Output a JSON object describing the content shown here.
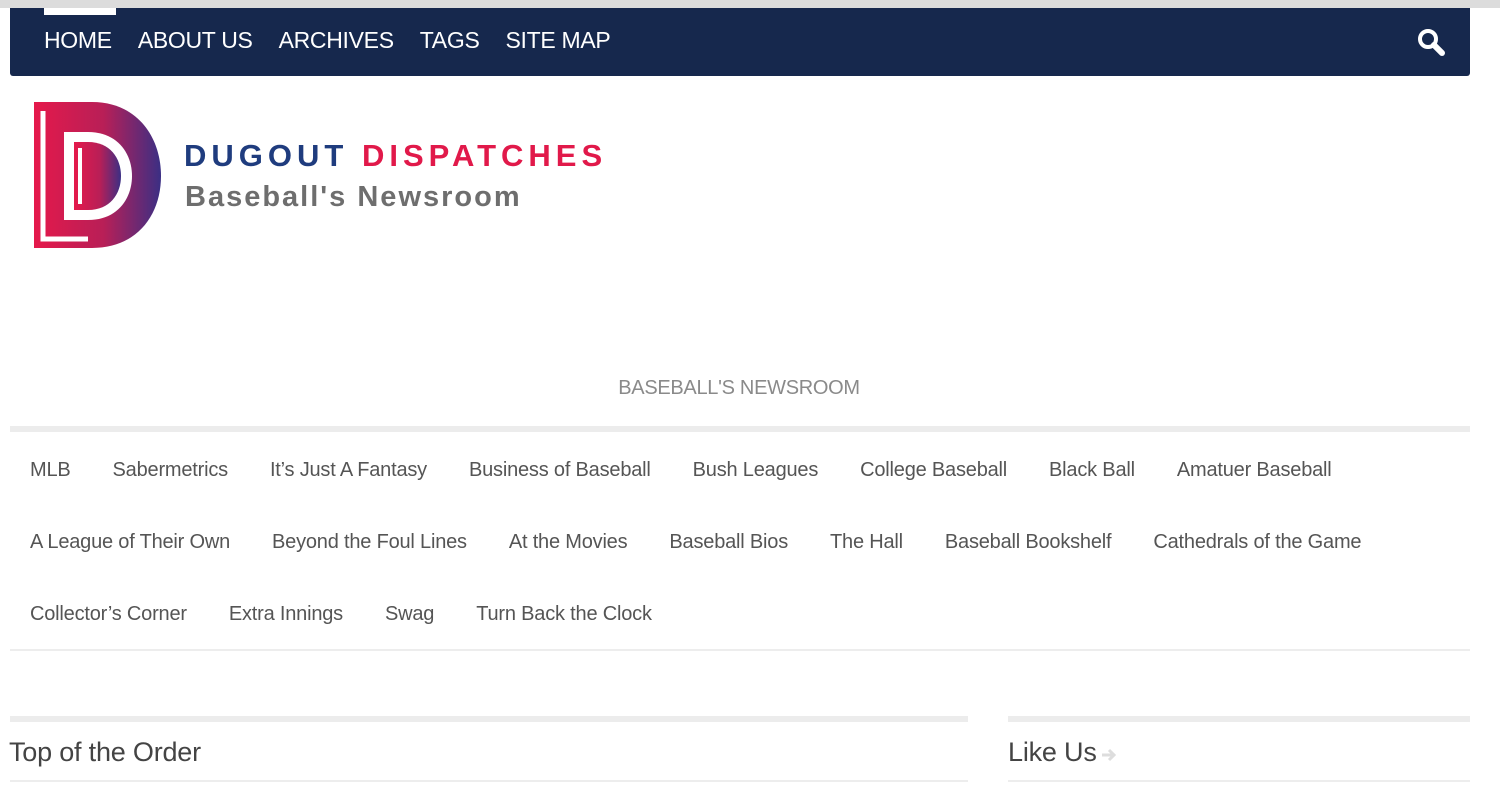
{
  "nav": {
    "items": [
      "HOME",
      "ABOUT US",
      "ARCHIVES",
      "TAGS",
      "SITE MAP"
    ],
    "active": "HOME",
    "search_icon": "search-icon"
  },
  "brand": {
    "title_part1": "DUGOUT",
    "title_part2": "DISPATCHES",
    "tagline": "Baseball's Newsroom",
    "logo_icon": "dugout-dispatches-logo",
    "colors": {
      "navy": "#1f3c7e",
      "red": "#e1194a",
      "gray": "#6e6e6e"
    }
  },
  "site_tagline": "BASEBALL'S NEWSROOM",
  "categories": {
    "row1": [
      "MLB",
      "Sabermetrics",
      "It’s Just A Fantasy",
      "Business of Baseball",
      "Bush Leagues",
      "College Baseball",
      "Black Ball",
      "Amatuer Baseball"
    ],
    "row2": [
      "A League of Their Own",
      "Beyond the Foul Lines",
      "At the Movies",
      "Baseball Bios",
      "The Hall",
      "Baseball Bookshelf",
      "Cathedrals of the Game"
    ],
    "row3": [
      "Collector’s Corner",
      "Extra Innings",
      "Swag",
      "Turn Back the Clock"
    ]
  },
  "sections": {
    "main_title": "Top of the Order",
    "side_title": "Like Us",
    "side_icon": "arrow-right-icon"
  },
  "colors": {
    "nav_bg": "#16284d",
    "text": "#555555"
  }
}
